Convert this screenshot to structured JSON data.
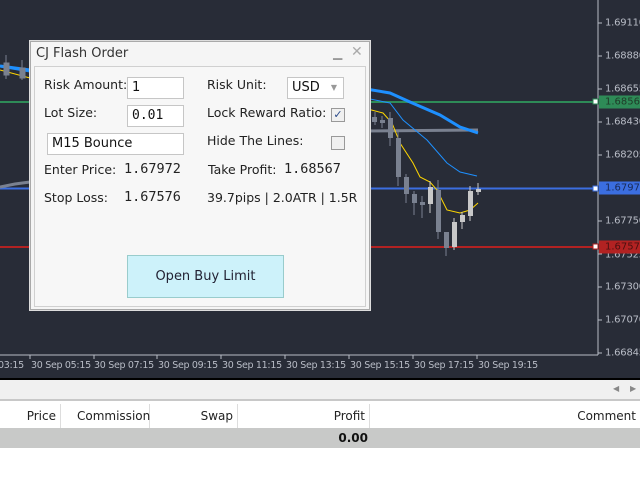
{
  "chart": {
    "price_ticks": [
      "1.69110",
      "1.68880",
      "1.68655",
      "1.68430",
      "1.68205",
      "1.67750",
      "1.67525",
      "1.67300",
      "1.67070",
      "1.66845"
    ],
    "time_ticks": [
      "03:15",
      "30 Sep 05:15",
      "30 Sep 07:15",
      "30 Sep 09:15",
      "30 Sep 11:15",
      "30 Sep 13:15",
      "30 Sep 15:15",
      "30 Sep 17:15",
      "30 Sep 19:15"
    ],
    "take_profit_line": "1.68567",
    "entry_line": "1.67972",
    "stop_loss_line": "1.67576",
    "colors": {
      "tp": "#2e8b57",
      "entry": "#3b6ee0",
      "sl": "#b22222",
      "ma_thick": "#1e90ff",
      "ma_thin": "#1e90ff",
      "ma_fast": "#ffd700",
      "background": "#282c37"
    }
  },
  "dialog": {
    "title": "CJ Flash Order",
    "risk_amount_label": "Risk Amount:",
    "risk_amount_value": "1",
    "risk_unit_label": "Risk Unit:",
    "risk_unit_value": "USD",
    "lot_size_label": "Lot Size:",
    "lot_size_value": "0.01",
    "lock_reward_label": "Lock Reward Ratio:",
    "lock_reward_checked": true,
    "comment_value": "M15 Bounce",
    "hide_lines_label": "Hide The Lines:",
    "hide_lines_checked": false,
    "enter_price_label": "Enter Price:",
    "enter_price_value": "1.67972",
    "take_profit_label": "Take Profit:",
    "take_profit_value": "1.68567",
    "stop_loss_label": "Stop Loss:",
    "stop_loss_value": "1.67576",
    "stats": "39.7pips | 2.0ATR | 1.5R",
    "button": "Open Buy Limit"
  },
  "table": {
    "columns": [
      "Price",
      "Commission",
      "Swap",
      "Profit",
      "Comment"
    ],
    "total_profit": "0.00"
  }
}
